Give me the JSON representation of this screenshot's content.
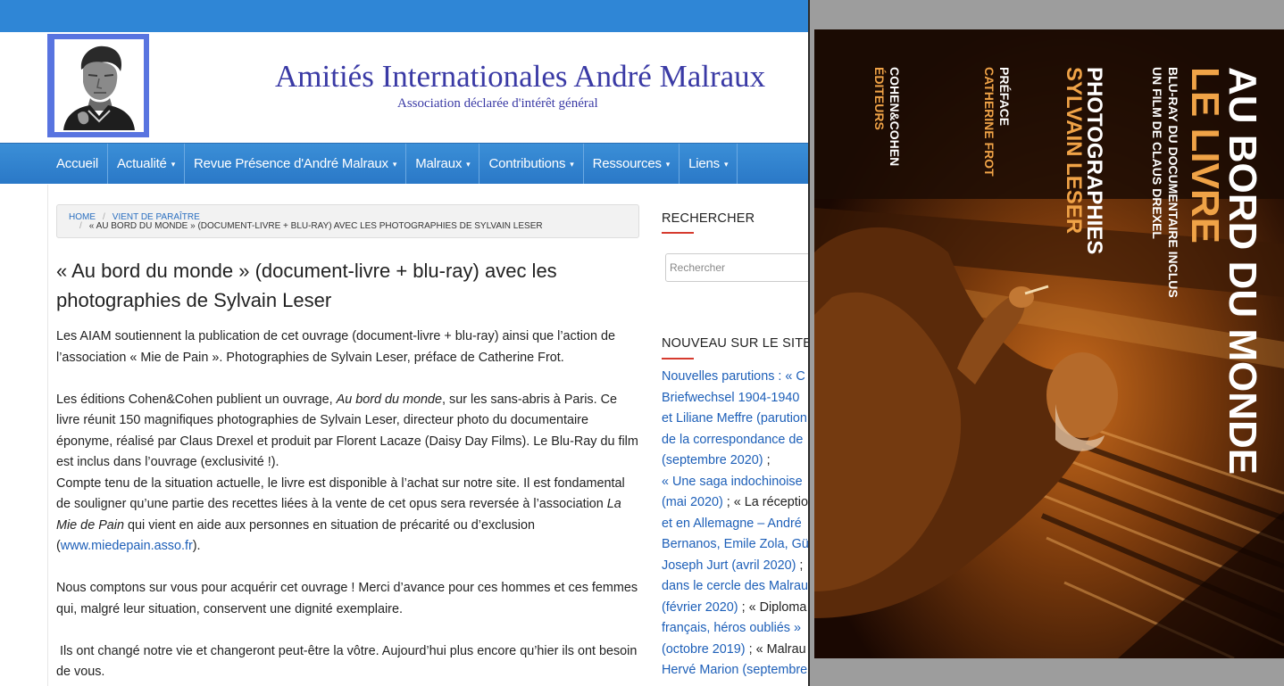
{
  "site": {
    "title": "Amitiés Internationales André Malraux",
    "subtitle": "Association déclarée d'intérêt général",
    "logo_icon": "portrait-photo",
    "colors": {
      "topbar": "#2f86d6",
      "nav": "#2f80cf",
      "title": "#3a3aa5",
      "link": "#1d5fb8",
      "accent_rule": "#d63b2f"
    }
  },
  "nav": {
    "items": [
      {
        "label": "Accueil",
        "has_dropdown": false
      },
      {
        "label": "Actualité",
        "has_dropdown": true
      },
      {
        "label": "Revue Présence d'André Malraux",
        "has_dropdown": true
      },
      {
        "label": "Malraux",
        "has_dropdown": true
      },
      {
        "label": "Contributions",
        "has_dropdown": true
      },
      {
        "label": "Ressources",
        "has_dropdown": true
      },
      {
        "label": "Liens",
        "has_dropdown": true
      }
    ],
    "caret": "▾"
  },
  "breadcrumb": {
    "home": "HOME",
    "separator": "/",
    "category": "VIENT DE PARAÎTRE",
    "current": "« AU BORD DU MONDE » (DOCUMENT-LIVRE + BLU-RAY) AVEC LES PHOTOGRAPHIES DE SYLVAIN LESER"
  },
  "article": {
    "title": "« Au bord du monde » (document-livre + blu-ray) avec les photographies de Sylvain Leser",
    "p1": "Les AIAM soutiennent la publication de cet ouvrage (document-livre + blu-ray) ainsi que l’action de l’association « Mie de Pain ». Photographies de Sylvain Leser, préface de Catherine Frot.",
    "p2_a": "Les éditions Cohen&Cohen publient un ouvrage, ",
    "p2_em": "Au bord du monde",
    "p2_b": ", sur les sans-abris à Paris. Ce livre réunit 150 magnifiques photographies de Sylvain Leser, directeur photo du documentaire éponyme, réalisé par Claus Drexel et produit par Florent Lacaze (Daisy Day Films). Le Blu-Ray du film est inclus dans l’ouvrage (exclusivité !).",
    "p3_a": "Compte tenu de la situation actuelle, le livre est disponible à l’achat sur notre site. Il est fondamental de souligner qu’une partie des recettes liées à la vente de cet opus sera reversée à l’association ",
    "p3_em": "La Mie de Pain",
    "p3_b": " qui vient en aide aux personnes en situation de précarité ou d’exclusion (",
    "p3_link": "www.miedepain.asso.fr",
    "p3_c": ").",
    "p4": "Nous comptons sur vous pour acquérir cet ouvrage ! Merci d’avance pour ces hommes et ces femmes qui, malgré leur situation, conservent une dignité exemplaire.",
    "p5": " Ils ont changé notre vie et changeront peut-être la vôtre. Aujourd’hui plus encore qu’hier ils ont besoin de vous."
  },
  "sidebar": {
    "search_title": "RECHERCHER",
    "search_placeholder": "Rechercher",
    "news_title": "NOUVEAU SUR LE SITE",
    "news_lines": [
      {
        "text": "Nouvelles parutions : « C",
        "type": "link"
      },
      {
        "text": "Briefwechsel 1904-1940",
        "type": "link"
      },
      {
        "text": "et Liliane Meffre (parution",
        "type": "link"
      },
      {
        "text": "de la correspondance de",
        "type": "link"
      },
      {
        "text": "(septembre 2020) ;",
        "type": "mixed",
        "link_part": "(septembre 2020)",
        "plain_part": " ;"
      },
      {
        "text": "« Une saga indochinoise",
        "type": "link"
      },
      {
        "text": "(mai 2020) ; « La réceptio",
        "type": "mixed",
        "link_part": "(mai 2020)",
        "plain_part": " ; « La réceptio"
      },
      {
        "text": "et en Allemagne – André",
        "type": "link"
      },
      {
        "text": "Bernanos, Emile Zola, Gü",
        "type": "link"
      },
      {
        "text": "Joseph Jurt (avril 2020) ;",
        "type": "mixed",
        "link_part": "Joseph Jurt (avril 2020)",
        "plain_part": " ;"
      },
      {
        "text": "dans le cercle des Malrau",
        "type": "link"
      },
      {
        "text": "(février 2020) ; « Diploma",
        "type": "mixed",
        "link_part": "(février 2020)",
        "plain_part": " ; « Diploma"
      },
      {
        "text": "français, héros oubliés »",
        "type": "link"
      },
      {
        "text": "(octobre 2019) ; « Malrau",
        "type": "mixed",
        "link_part": "(octobre 2019)",
        "plain_part": " ; « Malrau"
      },
      {
        "text": "Hervé Marion (septembre",
        "type": "link"
      }
    ]
  },
  "cover": {
    "title_line1": "AU BORD DU MONDE",
    "title_line2": "LE LIVRE",
    "tag1": "BLU-RAY DU DOCUMENTAIRE INCLUS",
    "tag2": "UN FILM DE CLAUS DREXEL",
    "photo_label": "PHOTOGRAPHIES",
    "photographer": "SYLVAIN LESER",
    "preface_label": "PRÉFACE",
    "preface_author": "CATHERINE FROT",
    "publisher1": "COHEN&COHEN",
    "publisher2": "ÉDITEURS",
    "colors": {
      "title": "#ffffff",
      "orange": "#f0a347",
      "background": "#1a0a02"
    }
  }
}
